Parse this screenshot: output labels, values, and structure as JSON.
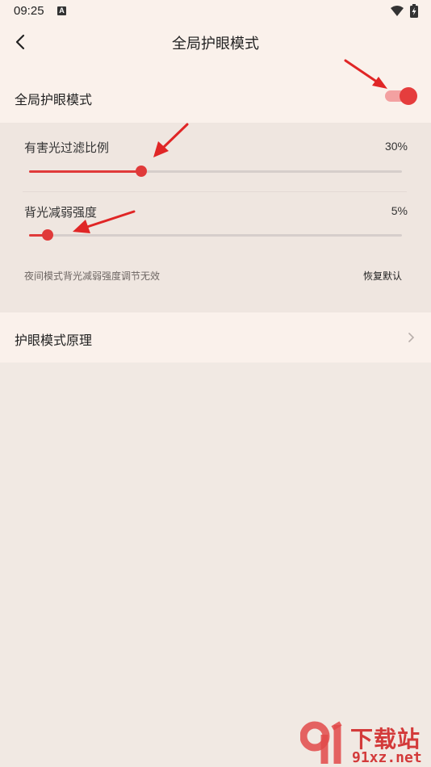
{
  "status_bar": {
    "time": "09:25",
    "badge_letter": "A",
    "icons": [
      "wifi-icon",
      "battery-charging-icon"
    ]
  },
  "header": {
    "title": "全局护眼模式",
    "back_icon": "chevron-left-icon"
  },
  "toggle_row": {
    "label": "全局护眼模式",
    "enabled": true
  },
  "sliders": [
    {
      "label": "有害光过滤比例",
      "value_text": "30%",
      "fraction": 0.3
    },
    {
      "label": "背光减弱强度",
      "value_text": "5%",
      "fraction": 0.05
    }
  ],
  "hint_text": "夜间模式背光减弱强度调节无效",
  "reset_label": "恢复默认",
  "nav_row": {
    "label": "护眼模式原理",
    "icon": "chevron-right-icon"
  },
  "watermark": {
    "top_text": "下载站",
    "bottom_text": "91xz.net"
  },
  "colors": {
    "accent": "#e03a3a",
    "toggle_track": "#f3a1a1",
    "background": "#f1e9e3",
    "row_background": "#faf1eb"
  }
}
